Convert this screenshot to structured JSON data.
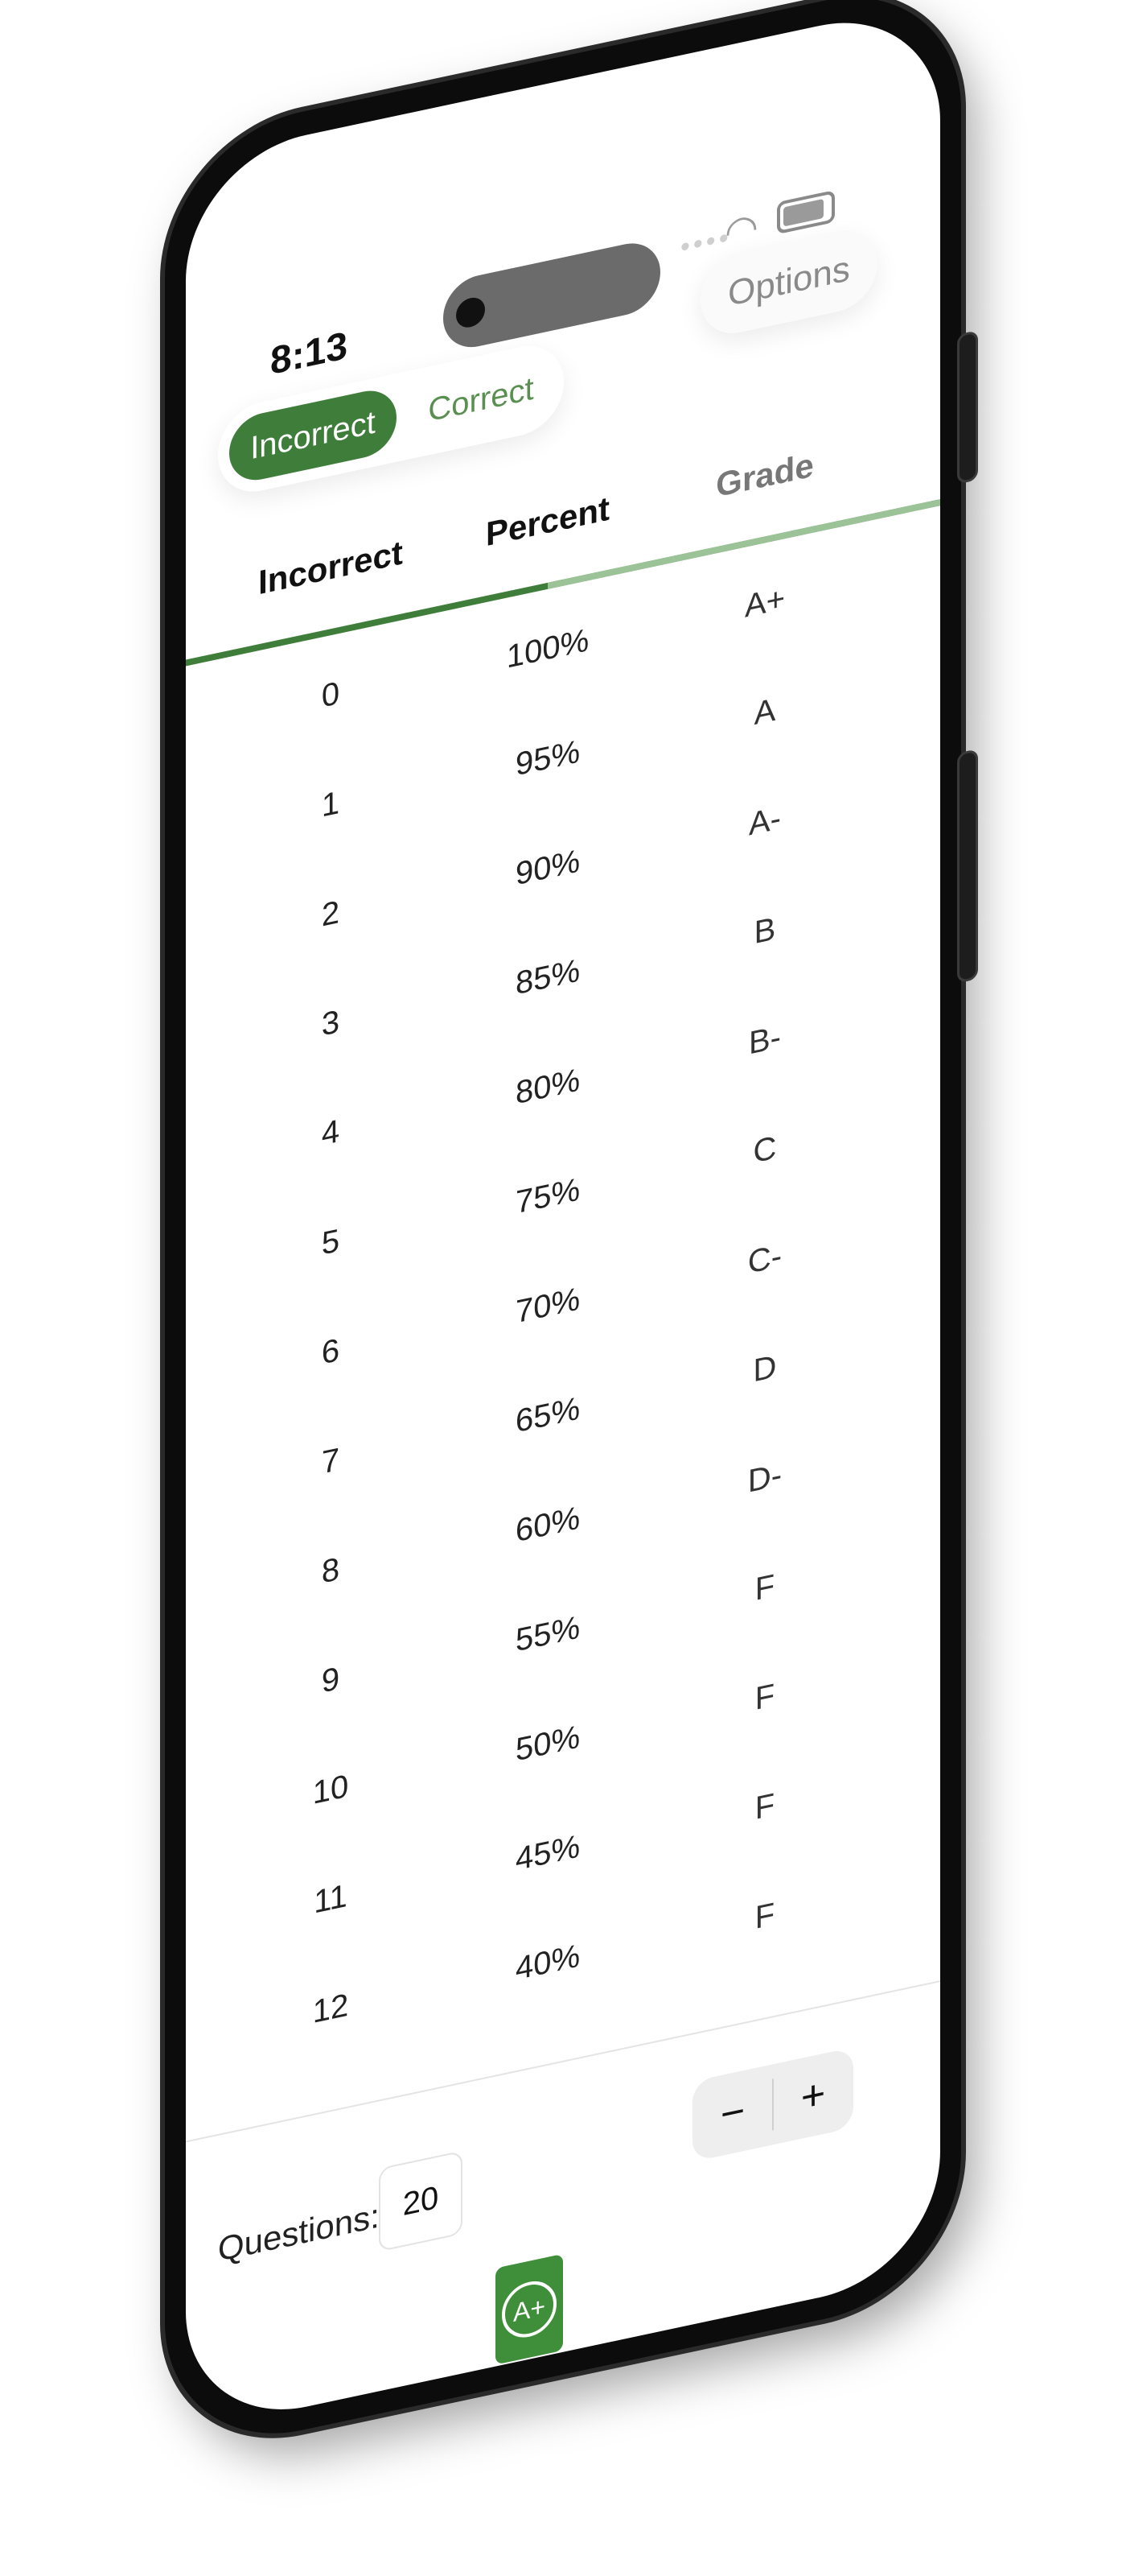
{
  "status": {
    "time": "8:13"
  },
  "segment": {
    "active_label": "Incorrect",
    "inactive_label": "Correct"
  },
  "options_label": "Options",
  "table": {
    "headers": [
      "Incorrect",
      "Percent",
      "Grade"
    ],
    "rows": [
      [
        "0",
        "100%",
        "A+"
      ],
      [
        "1",
        "95%",
        "A"
      ],
      [
        "2",
        "90%",
        "A-"
      ],
      [
        "3",
        "85%",
        "B"
      ],
      [
        "4",
        "80%",
        "B-"
      ],
      [
        "5",
        "75%",
        "C"
      ],
      [
        "6",
        "70%",
        "C-"
      ],
      [
        "7",
        "65%",
        "D"
      ],
      [
        "8",
        "60%",
        "D-"
      ],
      [
        "9",
        "55%",
        "F"
      ],
      [
        "10",
        "50%",
        "F"
      ],
      [
        "11",
        "45%",
        "F"
      ],
      [
        "12",
        "40%",
        "F"
      ]
    ]
  },
  "footer": {
    "questions_label": "Questions:",
    "questions_value": "20",
    "minus": "−",
    "plus": "+",
    "app_badge": "A+"
  },
  "colors": {
    "accent": "#3f7e3a",
    "accent_light": "#9cc398"
  }
}
